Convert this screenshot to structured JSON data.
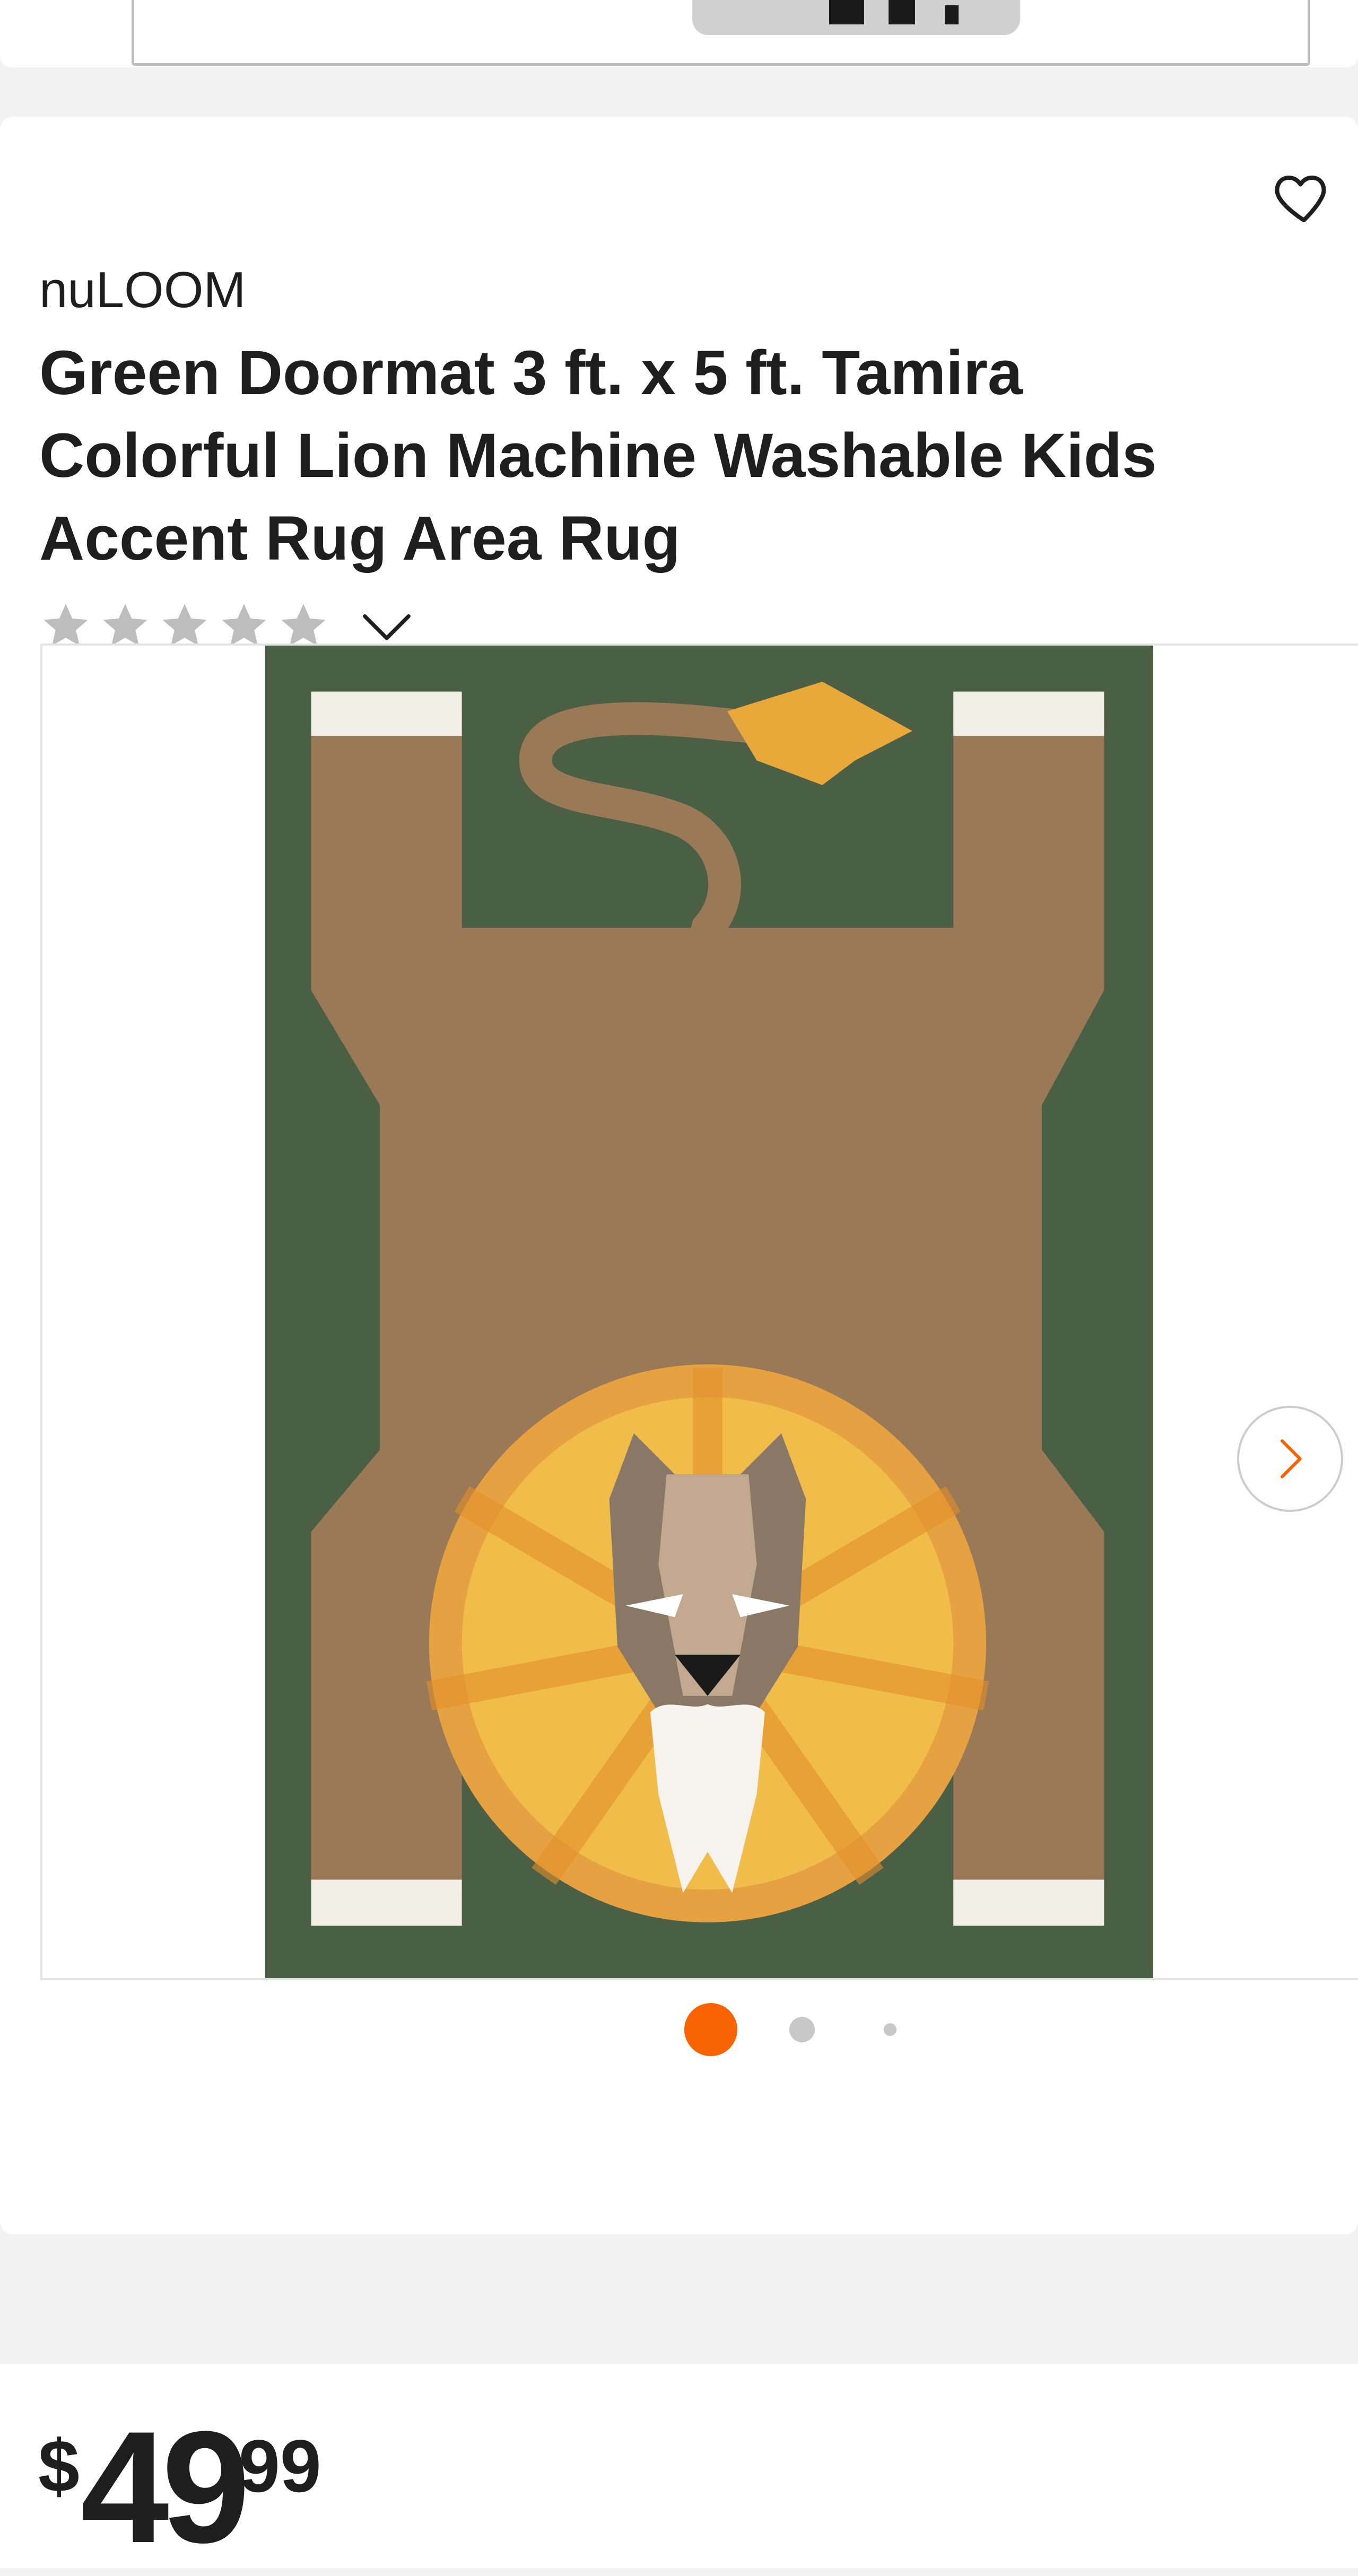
{
  "product": {
    "brand": "nuLOOM",
    "title": "Green Doormat 3 ft. x 5 ft. Tamira Colorful Lion Machine Washable Kids Accent Rug Area Rug",
    "rating": {
      "stars_filled": 0,
      "stars_total": 5,
      "star_color": "#bdbdbd"
    },
    "favorite_icon": "heart-outline-icon"
  },
  "gallery": {
    "image_description_icon": "rug-image",
    "next_icon": "chevron-right-icon",
    "dots_total": 3,
    "active_dot": 1,
    "accent_color": "#f96302"
  },
  "price": {
    "currency": "$",
    "dollars": "49",
    "cents": "99"
  }
}
